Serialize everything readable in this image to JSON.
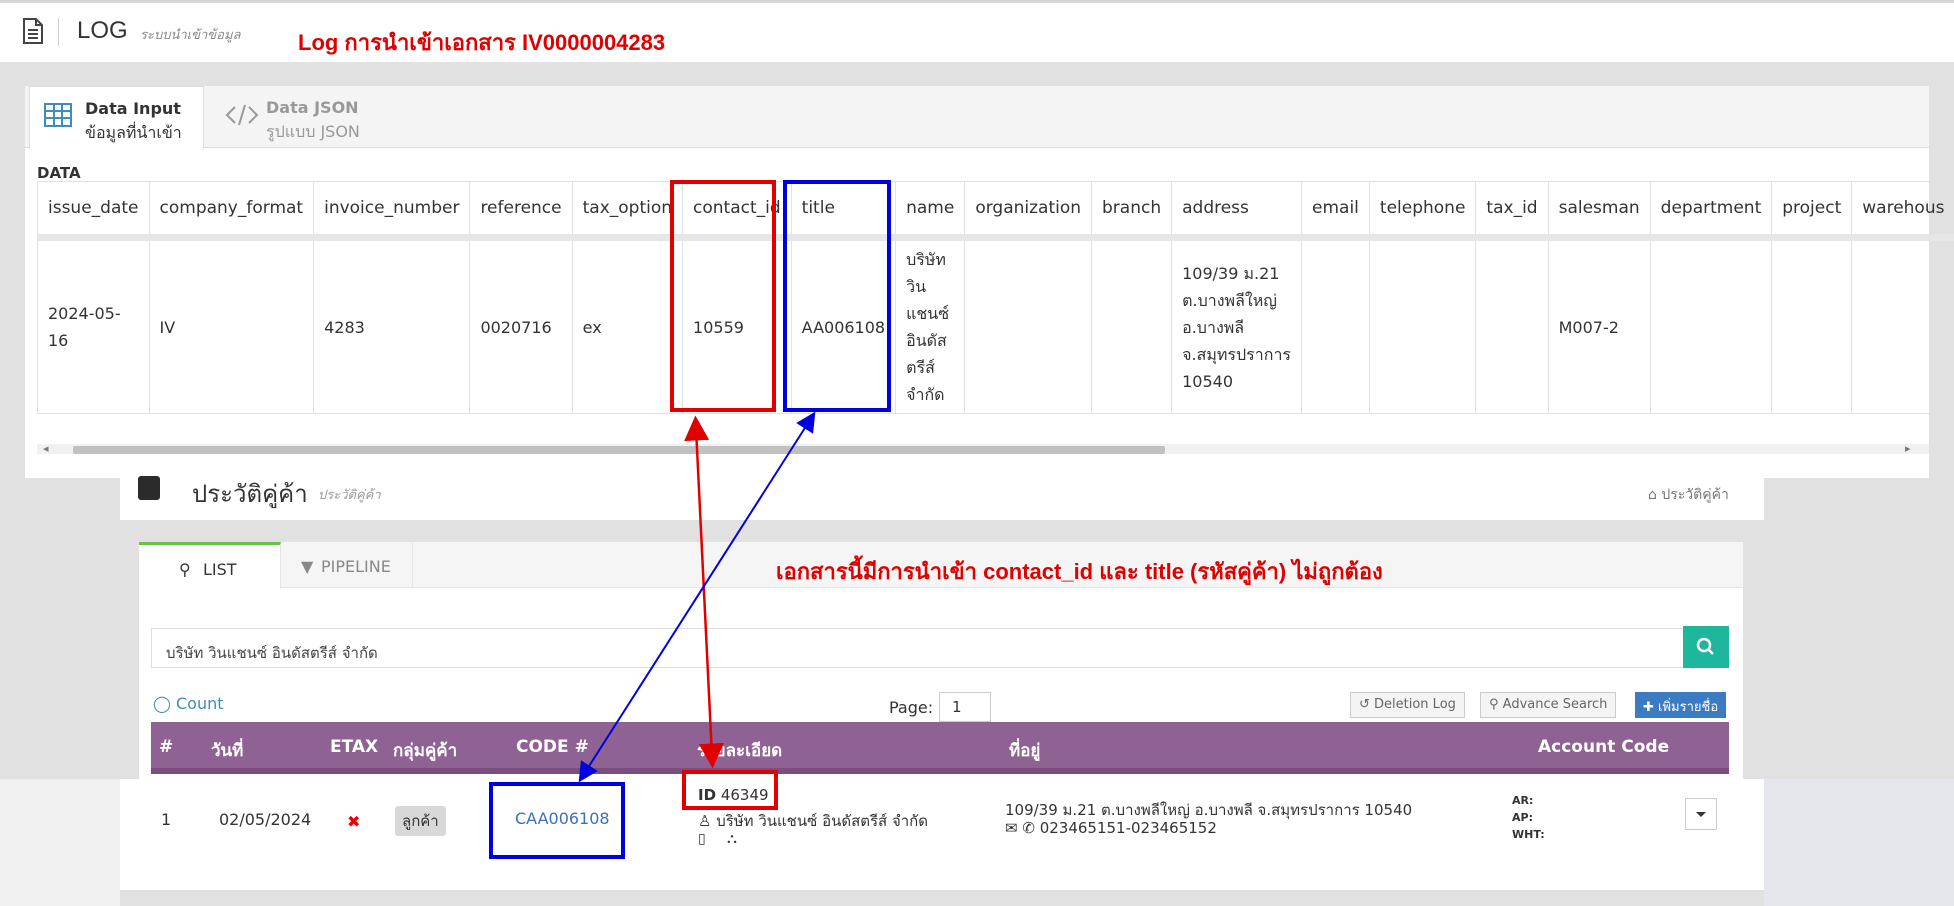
{
  "header": {
    "title": "LOG",
    "subtitle": "ระบบนำเข้าข้อมูล",
    "annotation": "Log การนำเข้าเอกสาร IV0000004283"
  },
  "log_tabs": [
    {
      "label": "Data Input",
      "sublabel": "ข้อมูลที่นำเข้า"
    },
    {
      "label": "Data JSON",
      "sublabel": "รูปแบบ JSON"
    }
  ],
  "data_section": {
    "label": "DATA",
    "columns": [
      "issue_date",
      "company_format",
      "invoice_number",
      "reference",
      "tax_option",
      "contact_id",
      "title",
      "name",
      "organization",
      "branch",
      "address",
      "email",
      "telephone",
      "tax_id",
      "salesman",
      "department",
      "project",
      "warehous"
    ],
    "row": {
      "issue_date": "2024-05-16",
      "company_format": "IV",
      "invoice_number": "4283",
      "reference": "0020716",
      "tax_option": "ex",
      "contact_id": "10559",
      "title": "AA006108",
      "name": "บริษัท วิน แชนซ์ อินดัส ตรีส์ จำกัด",
      "organization": "",
      "branch": "",
      "address": "109/39 ม.21 ต.บางพลีใหญ่ อ.บางพลี จ.สมุทรปราการ 10540",
      "email": "",
      "telephone": "",
      "tax_id": "",
      "salesman": "M007-2",
      "department": "",
      "project": "",
      "warehous": ""
    }
  },
  "partner_history": {
    "title": "ประวัติคู่ค้า",
    "subtitle": "ประวัติคู่ค้า",
    "breadcrumb": "ประวัติคู่ค้า",
    "tabs": [
      "LIST",
      "PIPELINE"
    ],
    "annotation": "เอกสารนี้มีการนำเข้า contact_id และ title (รหัสคู่ค้า) ไม่ถูกต้อง",
    "search_value": "บริษัท วินแชนซ์ อินดัสตรีส์ จำกัด",
    "count_label": "Count",
    "page_label": "Page:",
    "page_value": "1",
    "buttons": {
      "deletion_log": "Deletion Log",
      "advance_search": "Advance Search",
      "add": "เพิ่มรายชื่อ"
    },
    "table_headers": [
      "#",
      "วันที่",
      "ETAX",
      "กลุ่มคู่ค้า",
      "CODE #",
      "รายละเอียด",
      "ที่อยู่",
      "Account Code"
    ],
    "row": {
      "index": "1",
      "date": "02/05/2024",
      "etax": "✖",
      "group": "ลูกค้า",
      "code": "CAA006108",
      "id_label": "ID",
      "id_value": "46349",
      "name": "บริษัท วินแชนซ์ อินดัสตรีส์ จำกัด",
      "address": "109/39 ม.21 ต.บางพลีใหญ่ อ.บางพลี จ.สมุทรปราการ 10540",
      "phone": "023465151-023465152",
      "ar": "AR:",
      "ap": "AP:",
      "wht": "WHT:"
    }
  },
  "colors": {
    "annotation_red": "#e00000",
    "annotation_blue": "#0000e0",
    "table_header": "#8e6393",
    "search_button": "#1fb79b",
    "tab_accent": "#6abf4b"
  }
}
